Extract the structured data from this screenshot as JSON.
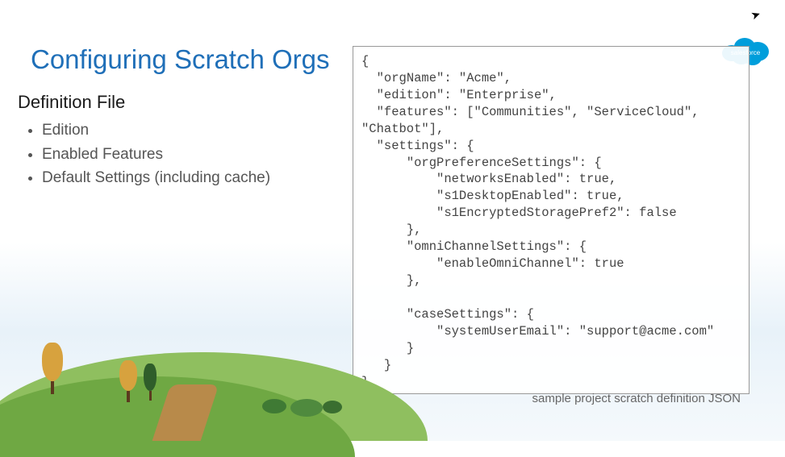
{
  "title": "Configuring Scratch Orgs",
  "subtitle": "Definition File",
  "bullets": {
    "b0": "Edition",
    "b1": "Enabled Features",
    "b2": "Default Settings (including cache)"
  },
  "code": "{\n  \"orgName\": \"Acme\",\n  \"edition\": \"Enterprise\",\n  \"features\": [\"Communities\", \"ServiceCloud\", \"Chatbot\"],\n  \"settings\": {\n      \"orgPreferenceSettings\": {\n          \"networksEnabled\": true,\n          \"s1DesktopEnabled\": true,\n          \"s1EncryptedStoragePref2\": false\n      },\n      \"omniChannelSettings\": {\n          \"enableOmniChannel\": true\n      },\n\n      \"caseSettings\": {\n          \"systemUserEmail\": \"support@acme.com\"\n      }\n   }\n}",
  "code_caption": "sample project scratch definition JSON",
  "logo_label": "salesforce"
}
